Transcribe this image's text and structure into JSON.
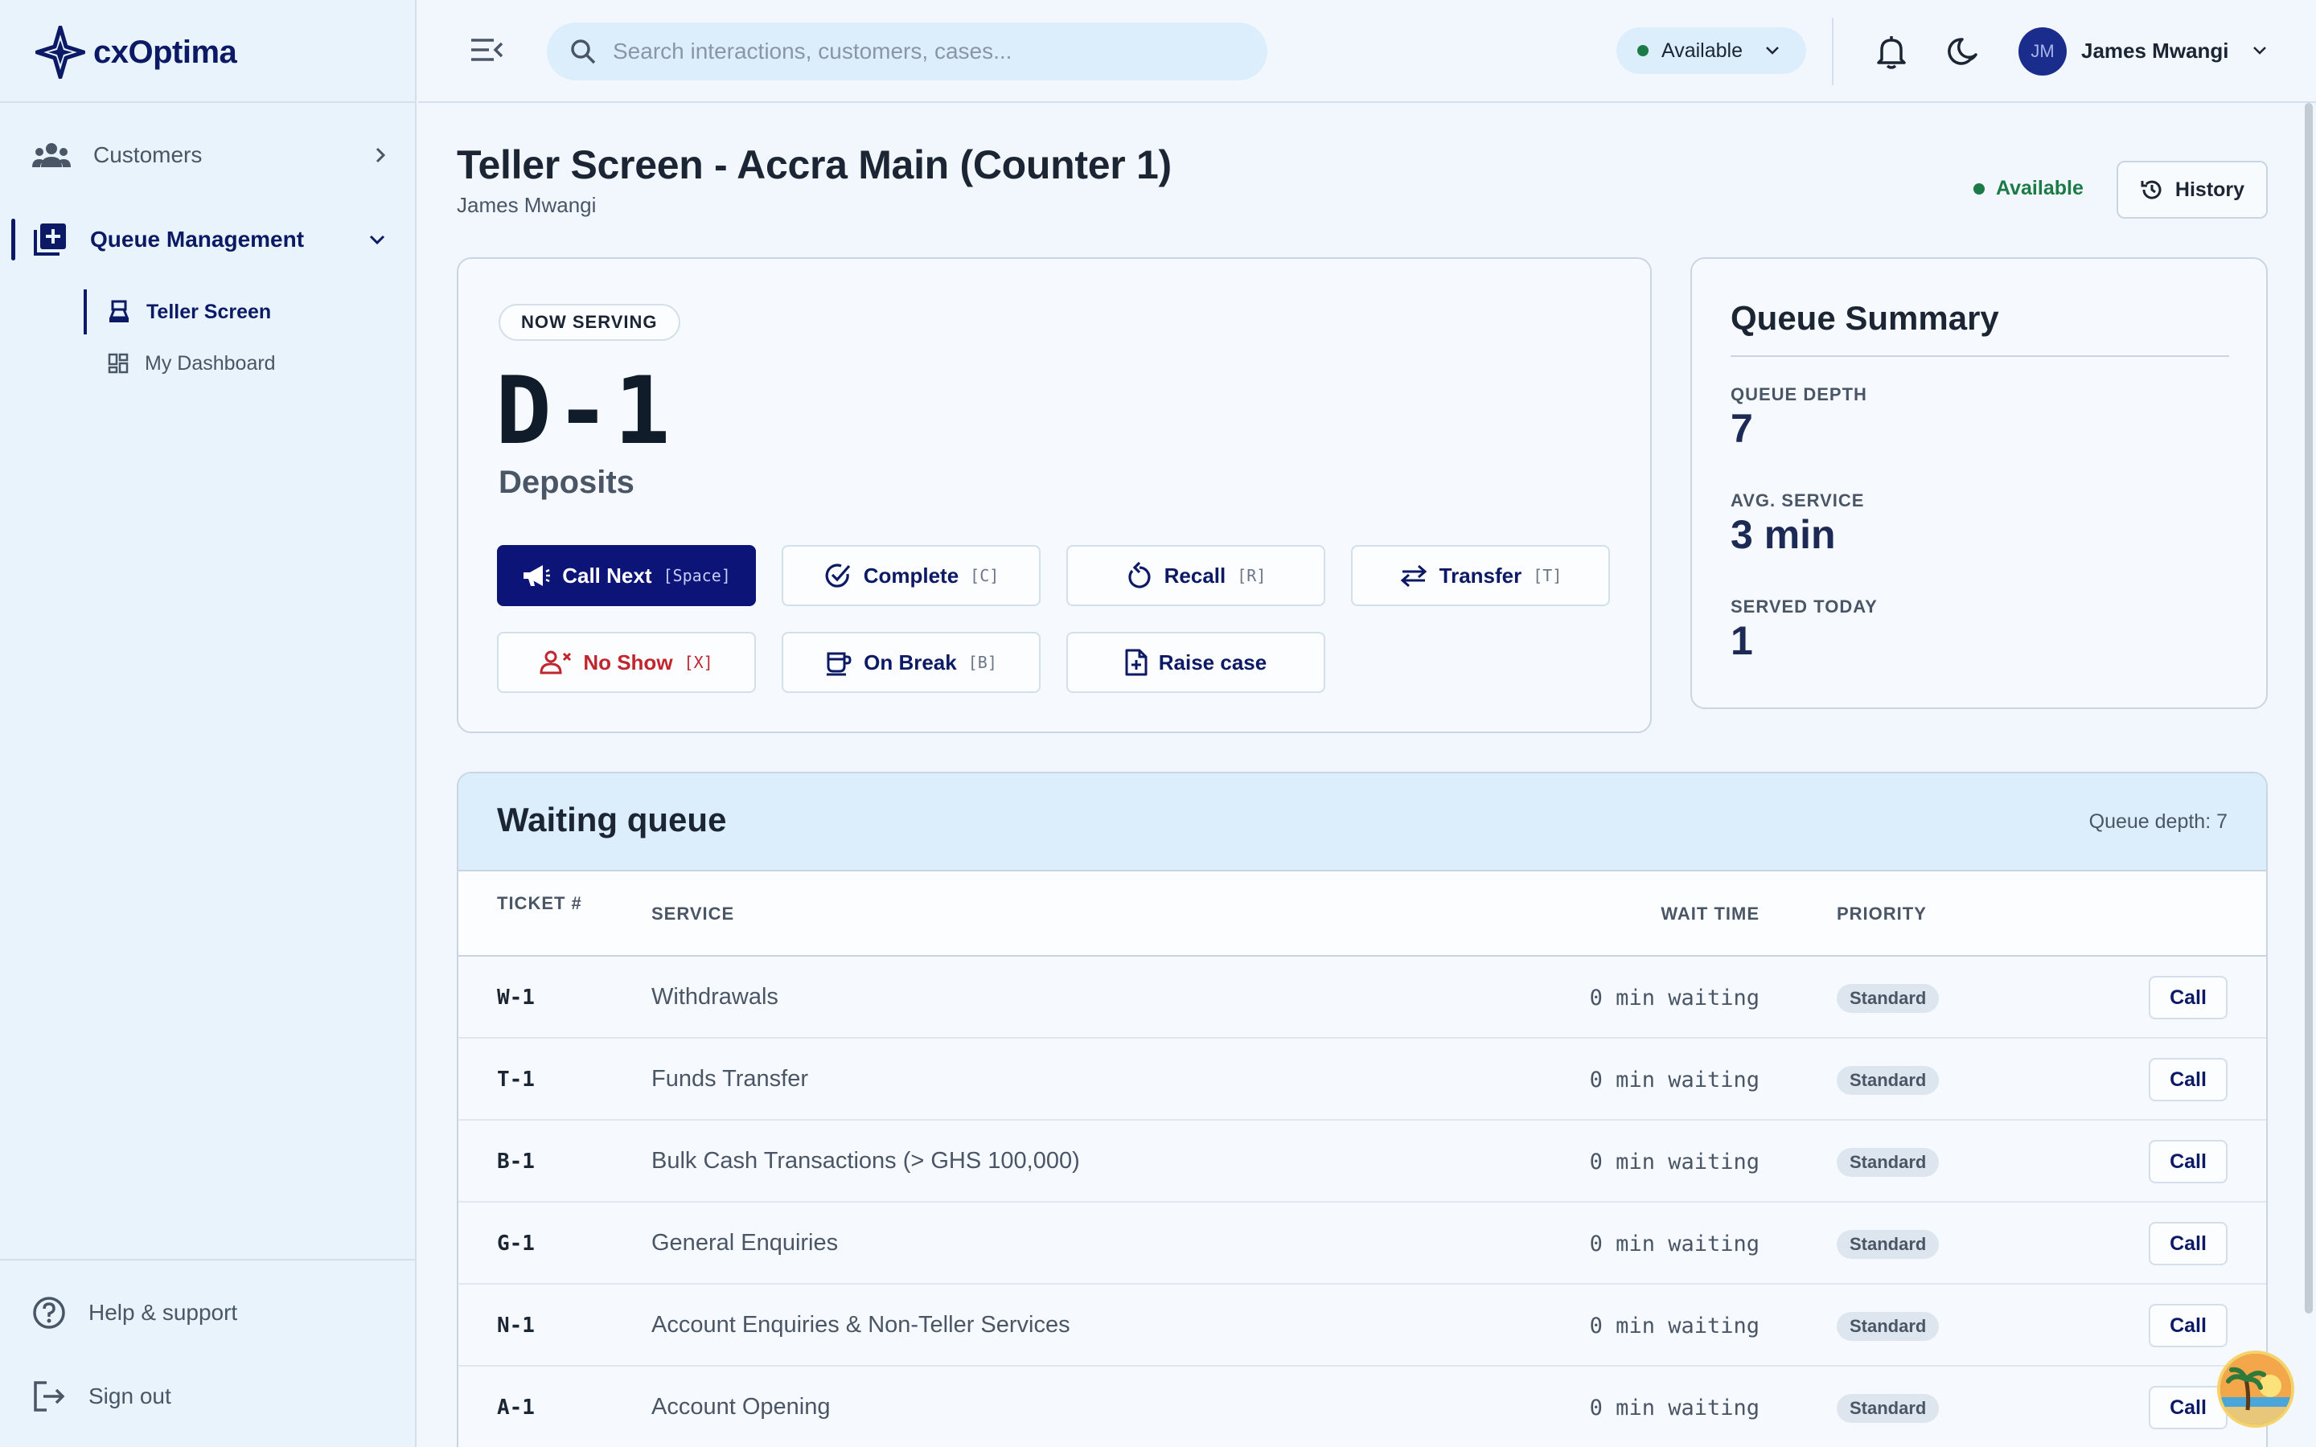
{
  "brand": {
    "name": "cxOptima"
  },
  "sidebar": {
    "items": [
      {
        "label": "Customers",
        "icon": "users-icon"
      },
      {
        "label": "Queue Management",
        "icon": "queue-add-icon"
      }
    ],
    "sub_items": [
      {
        "label": "Teller Screen",
        "icon": "teller-icon"
      },
      {
        "label": "My Dashboard",
        "icon": "dashboard-icon"
      }
    ],
    "footer": [
      {
        "label": "Help & support",
        "icon": "help-icon"
      },
      {
        "label": "Sign out",
        "icon": "sign-out-icon"
      }
    ]
  },
  "header": {
    "search_placeholder": "Search interactions, customers, cases...",
    "status": "Available",
    "user_initials": "JM",
    "user_name": "James Mwangi"
  },
  "page": {
    "title": "Teller Screen - Accra Main (Counter 1)",
    "subtitle": "James Mwangi",
    "status": "Available",
    "history_label": "History"
  },
  "serving": {
    "badge": "NOW SERVING",
    "ticket": "D-1",
    "service": "Deposits",
    "actions": [
      {
        "label": "Call Next",
        "key": "[Space]"
      },
      {
        "label": "Complete",
        "key": "[C]"
      },
      {
        "label": "Recall",
        "key": "[R]"
      },
      {
        "label": "Transfer",
        "key": "[T]"
      },
      {
        "label": "No Show",
        "key": "[X]"
      },
      {
        "label": "On Break",
        "key": "[B]"
      },
      {
        "label": "Raise case",
        "key": ""
      }
    ]
  },
  "summary": {
    "title": "Queue Summary",
    "stats": [
      {
        "label": "QUEUE DEPTH",
        "value": "7"
      },
      {
        "label": "AVG. SERVICE",
        "value": "3 min"
      },
      {
        "label": "SERVED TODAY",
        "value": "1"
      }
    ]
  },
  "queue": {
    "title": "Waiting queue",
    "depth_label": "Queue depth: 7",
    "columns": {
      "ticket": "TICKET #",
      "service": "SERVICE",
      "wait": "WAIT TIME",
      "priority": "PRIORITY"
    },
    "call_label": "Call",
    "rows": [
      {
        "ticket": "W-1",
        "service": "Withdrawals",
        "wait": "0 min waiting",
        "priority": "Standard"
      },
      {
        "ticket": "T-1",
        "service": "Funds Transfer",
        "wait": "0 min waiting",
        "priority": "Standard"
      },
      {
        "ticket": "B-1",
        "service": "Bulk Cash Transactions (> GHS 100,000)",
        "wait": "0 min waiting",
        "priority": "Standard"
      },
      {
        "ticket": "G-1",
        "service": "General Enquiries",
        "wait": "0 min waiting",
        "priority": "Standard"
      },
      {
        "ticket": "N-1",
        "service": "Account Enquiries & Non-Teller Services",
        "wait": "0 min waiting",
        "priority": "Standard"
      },
      {
        "ticket": "A-1",
        "service": "Account Opening",
        "wait": "0 min waiting",
        "priority": "Standard"
      }
    ]
  },
  "colors": {
    "accent": "#0c1577",
    "available": "#1b7a45",
    "danger": "#c0262d"
  }
}
